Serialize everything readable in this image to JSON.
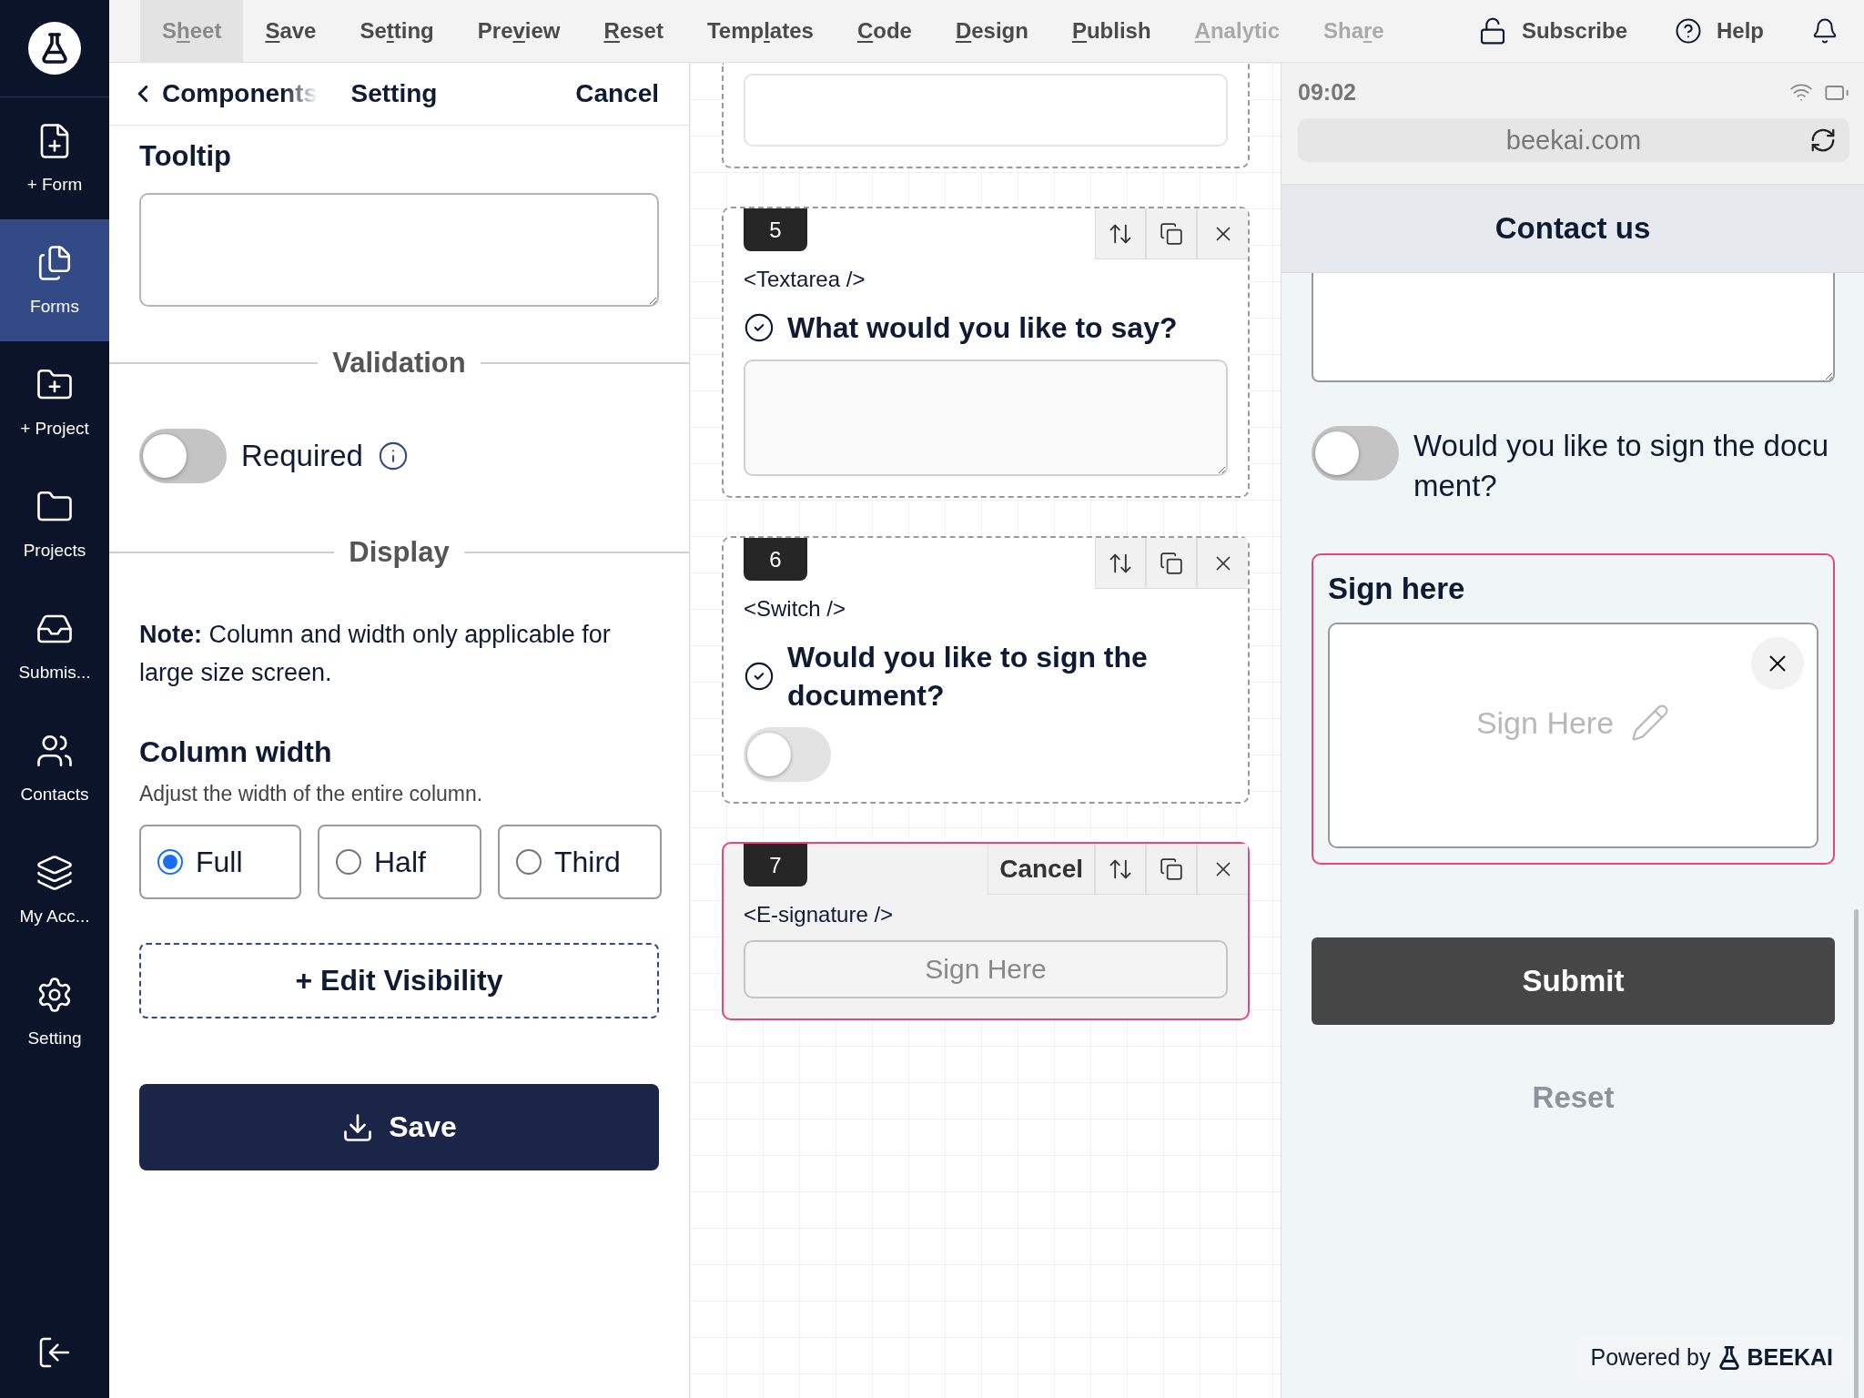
{
  "menu": {
    "items": [
      {
        "pre": "S",
        "key": "h",
        "post": "eet",
        "selected": true,
        "disabled": false
      },
      {
        "key": "S",
        "post": "ave",
        "selected": false,
        "disabled": false
      },
      {
        "pre": "Se",
        "key": "t",
        "post": "ting",
        "selected": false,
        "disabled": false
      },
      {
        "pre": "Pre",
        "key": "v",
        "post": "iew",
        "selected": false,
        "disabled": false
      },
      {
        "key": "R",
        "post": "eset",
        "selected": false,
        "disabled": false
      },
      {
        "pre": "Temp",
        "key": "l",
        "post": "ates",
        "selected": false,
        "disabled": false
      },
      {
        "key": "C",
        "post": "ode",
        "selected": false,
        "disabled": false
      },
      {
        "key": "D",
        "post": "esign",
        "selected": false,
        "disabled": false
      },
      {
        "key": "P",
        "post": "ublish",
        "selected": false,
        "disabled": false
      },
      {
        "key": "A",
        "post": "nalytic",
        "selected": false,
        "disabled": true
      },
      {
        "pre": "Sha",
        "key": "r",
        "post": "e",
        "selected": false,
        "disabled": true
      }
    ],
    "subscribe": "Subscribe",
    "help": "Help"
  },
  "sidebar": {
    "items": [
      {
        "label": "+ Form",
        "selected": false
      },
      {
        "label": "Forms",
        "selected": true
      },
      {
        "label": "+ Project",
        "selected": false
      },
      {
        "label": "Projects",
        "selected": false
      },
      {
        "label": "Submis...",
        "selected": false
      },
      {
        "label": "Contacts",
        "selected": false
      },
      {
        "label": "My Acc...",
        "selected": false
      },
      {
        "label": "Setting",
        "selected": false
      }
    ]
  },
  "settings_panel": {
    "back": "Components",
    "title": "Setting",
    "cancel": "Cancel",
    "tooltip_label": "Tooltip",
    "validation_heading": "Validation",
    "required": {
      "label": "Required",
      "on": false
    },
    "display_heading": "Display",
    "note": "**Note:** Column and width only applicable for large size screen.",
    "column_width": {
      "title": "Column width",
      "hint": "Adjust the width of the entire column.",
      "options": [
        {
          "label": "Full",
          "selected": true
        },
        {
          "label": "Half",
          "selected": false
        },
        {
          "label": "Third",
          "selected": false
        }
      ]
    },
    "edit_visibility": "+ Edit Visibility",
    "save": "Save"
  },
  "canvas": {
    "cards": [
      {
        "kind": "input",
        "selected": false
      },
      {
        "kind": "textarea",
        "number": "5",
        "tag": "<Textarea />",
        "question": "What would you like to say?",
        "selected": false
      },
      {
        "kind": "switch",
        "number": "6",
        "tag": "<Switch />",
        "question": "Would you like to sign the document?",
        "on": false,
        "selected": false
      },
      {
        "kind": "signature",
        "number": "7",
        "tag": "<E-signature />",
        "cancel": "Cancel",
        "button": "Sign Here",
        "selected": true
      }
    ]
  },
  "preview": {
    "time": "09:02",
    "url": "beekai.com",
    "header": "Contact us",
    "fields": [
      {
        "kind": "textarea"
      },
      {
        "kind": "switch",
        "label": "Would you like to sign the document?",
        "on": false
      },
      {
        "kind": "signature",
        "label": "Sign here",
        "placeholder": "Sign Here"
      }
    ],
    "submit": "Submit",
    "reset": "Reset",
    "powered_by": "Powered by",
    "brand": "BEEKAI"
  }
}
